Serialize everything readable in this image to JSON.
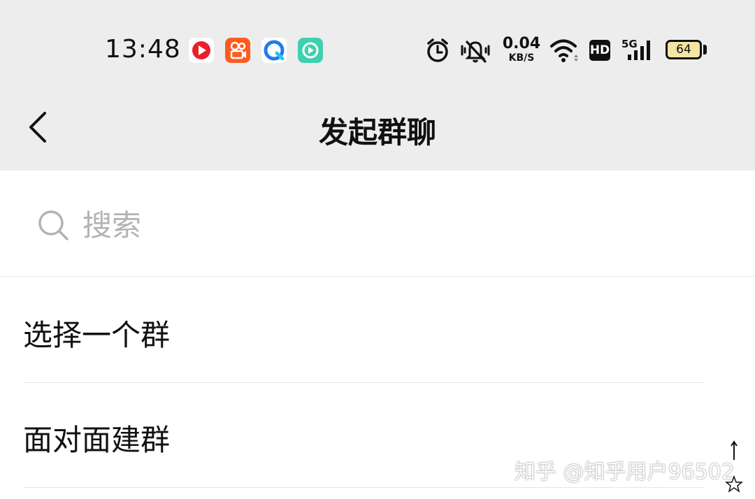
{
  "status_bar": {
    "time": "13:48",
    "app_icons": [
      "red-play-app-icon",
      "orange-video-app-icon",
      "blue-browser-app-icon",
      "teal-media-app-icon"
    ],
    "net_speed_value": "0.04",
    "net_speed_unit": "KB/S",
    "network": "5G",
    "hd_badge": "HD",
    "battery_level": "64",
    "colors": {
      "bar_bg": "#ededed",
      "battery_fill": "#f3e6a3"
    }
  },
  "nav": {
    "title": "发起群聊"
  },
  "search": {
    "placeholder": "搜索",
    "value": ""
  },
  "list": {
    "items": [
      {
        "label": "选择一个群"
      },
      {
        "label": "面对面建群"
      }
    ]
  },
  "watermark": {
    "text": "知乎 @知乎用户96502"
  }
}
